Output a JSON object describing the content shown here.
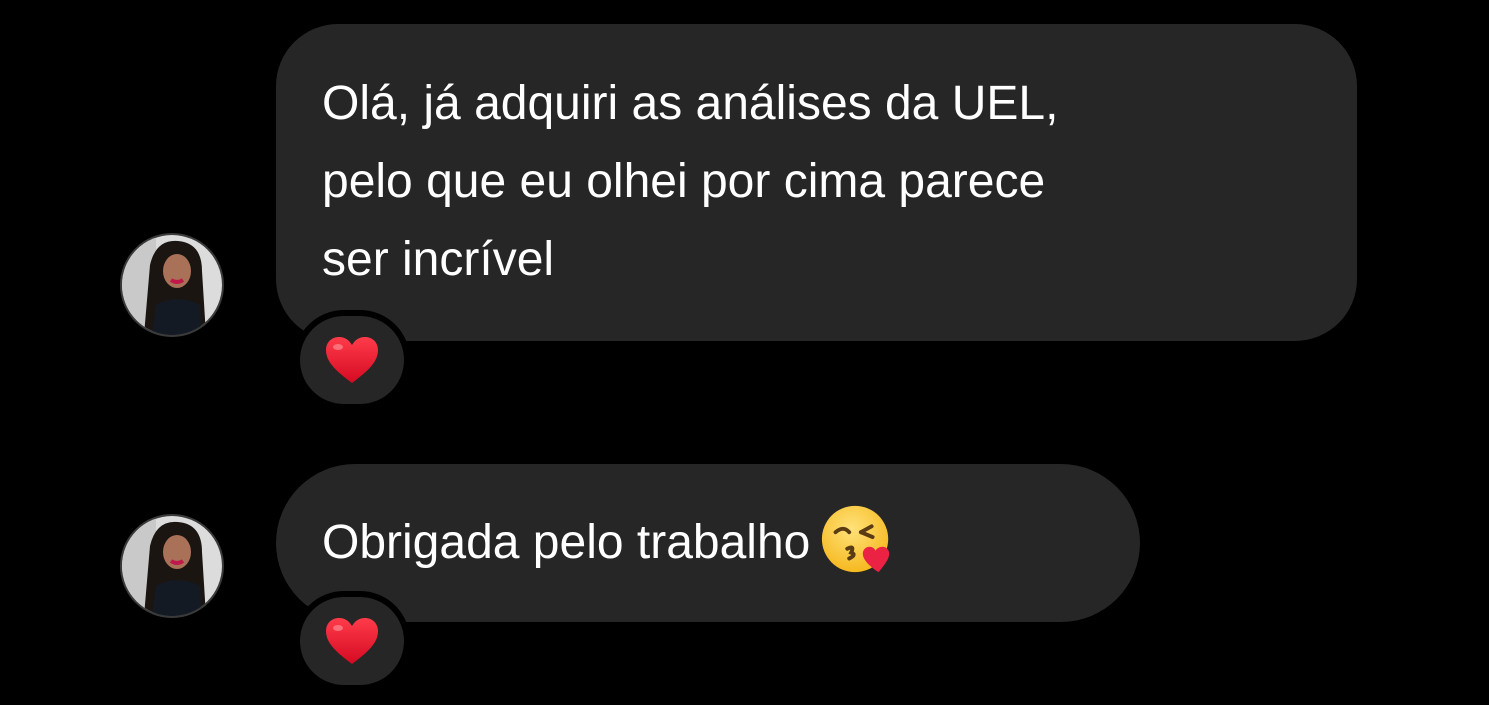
{
  "messages": [
    {
      "lines": [
        "Olá, já adquiri as análises da UEL,",
        "pelo que eu olhei por cima parece",
        "ser incrível"
      ],
      "reaction": "red-heart-icon"
    },
    {
      "text": "Obrigada pelo trabalho",
      "emoji": "face-blowing-kiss-icon",
      "reaction": "red-heart-icon"
    }
  ],
  "colors": {
    "background": "#000000",
    "bubble": "#262626",
    "text": "#ffffff",
    "heart": "#e0102c"
  }
}
